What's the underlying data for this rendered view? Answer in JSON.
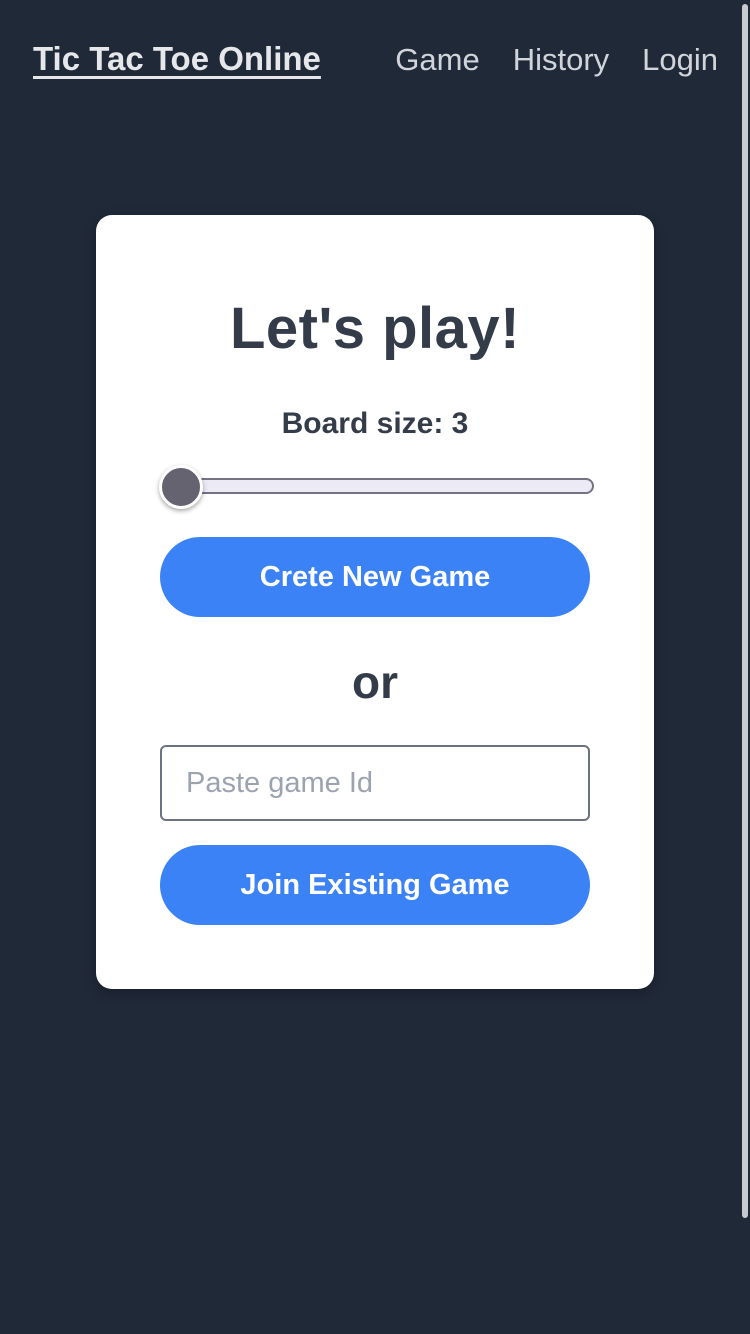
{
  "nav": {
    "brand": "Tic Tac Toe Online",
    "links": [
      "Game",
      "History",
      "Login"
    ]
  },
  "card": {
    "title": "Let's play!",
    "board_size_label": "Board size: 3",
    "board_size": {
      "value": 3,
      "min": 3,
      "max": 10
    },
    "create_button": "Crete New Game",
    "or_label": "or",
    "game_id_placeholder": "Paste game Id",
    "game_id_value": "",
    "join_button": "Join Existing Game"
  },
  "colors": {
    "background": "#202938",
    "card": "#ffffff",
    "accent": "#3b82f6",
    "text_dark": "#343c4a",
    "nav_text": "#d1d5db"
  }
}
